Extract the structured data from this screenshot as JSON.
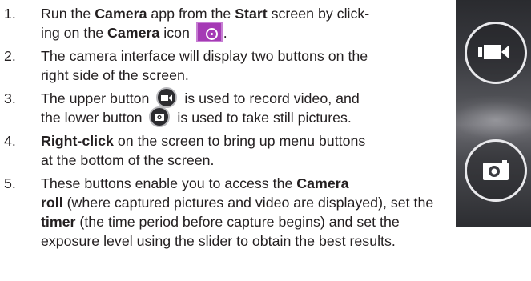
{
  "steps": [
    {
      "number": "1.",
      "line1": {
        "a": "Run the ",
        "b": "Camera",
        "c": " app from the ",
        "d": "Start",
        "e": " screen by click-"
      },
      "line2": {
        "a": "ing on the ",
        "b": "Camera",
        "c": " icon ",
        "d": "."
      }
    },
    {
      "number": "2.",
      "line1": "The camera interface will display two buttons on the",
      "line2": "right side of the screen."
    },
    {
      "number": "3.",
      "line1": {
        "a": "The upper button ",
        "b": " is used to record video, and"
      },
      "line2": {
        "a": "the lower button ",
        "b": " is used to take still pictures."
      }
    },
    {
      "number": "4.",
      "line1": {
        "a": "Right-click",
        "b": " on the screen to bring up menu buttons"
      },
      "line2": "at the bottom of the screen."
    },
    {
      "number": "5.",
      "line1": {
        "a": "These buttons enable you to access the ",
        "b": "Camera"
      },
      "line2": {
        "a": "roll",
        "b": " (where captured pictures and video are displayed), set the"
      },
      "line3": {
        "a": "timer",
        "b": " (the time period before capture begins) and set the"
      },
      "line4": "exposure level using the slider to obtain the best results."
    }
  ],
  "icons": {
    "camera_app": "camera-app-icon",
    "video": "video-camera-icon",
    "photo": "still-camera-icon"
  },
  "colors": {
    "text": "#231f20",
    "camera_tile": "#a53ab5",
    "button_ring": "#e9e9ec"
  }
}
